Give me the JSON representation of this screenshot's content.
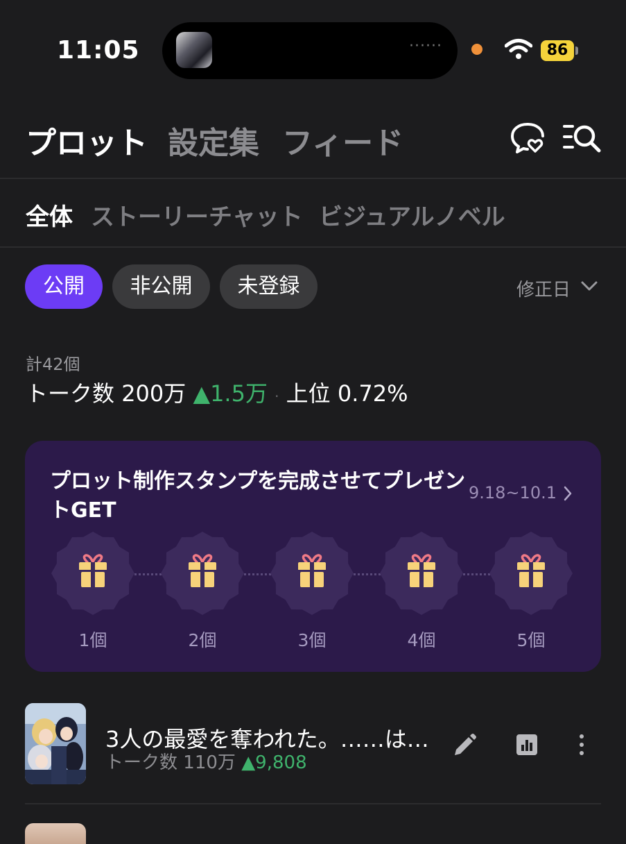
{
  "status_bar": {
    "time": "11:05",
    "island_dots": "······",
    "battery": "86"
  },
  "header": {
    "tabs": [
      {
        "label": "プロット",
        "active": true
      },
      {
        "label": "設定集",
        "active": false
      },
      {
        "label": "フィード",
        "active": false
      }
    ],
    "icons": [
      "chat-heart-icon",
      "search-list-icon"
    ]
  },
  "sub_tabs": [
    {
      "label": "全体",
      "active": true
    },
    {
      "label": "ストーリーチャット",
      "active": false
    },
    {
      "label": "ビジュアルノベル",
      "active": false
    }
  ],
  "filters": [
    {
      "label": "公開",
      "active": true
    },
    {
      "label": "非公開",
      "active": false
    },
    {
      "label": "未登録",
      "active": false
    }
  ],
  "sort": {
    "label": "修正日"
  },
  "summary": {
    "total": "計42個",
    "talk_label": "トーク数",
    "talk_count": "200万",
    "talk_delta": "▲1.5万",
    "separator": "·",
    "rank_label": "上位",
    "rank_value": "0.72%"
  },
  "promo": {
    "title": "プロット制作スタンプを完成させてプレゼントGET",
    "date_range": "9.18~10.1",
    "stamps": [
      "1個",
      "2個",
      "3個",
      "4個",
      "5個"
    ]
  },
  "plots": [
    {
      "title": "3人の最愛を奪われた。……は…",
      "talk_label": "トーク数",
      "talk_count": "110万",
      "talk_delta": "▲9,808"
    }
  ],
  "colors": {
    "accent": "#6c3cf5",
    "up": "#3fb36c",
    "card_bg": "#2c1a4a",
    "bg": "#1c1c1e"
  }
}
